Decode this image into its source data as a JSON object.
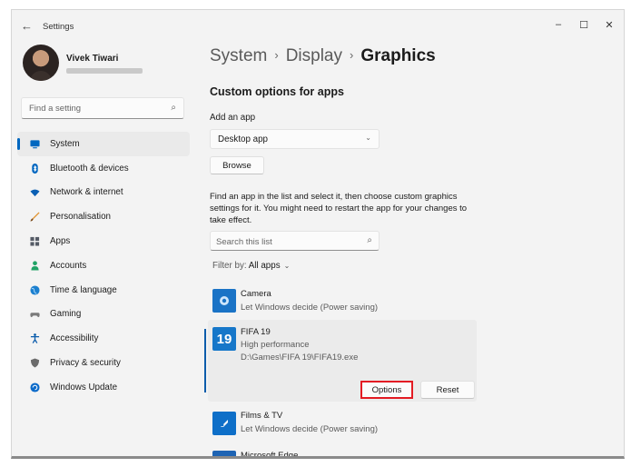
{
  "window": {
    "title": "Settings",
    "back_glyph": "←",
    "minimize_glyph": "–",
    "maximize_glyph": "☐",
    "close_glyph": "✕"
  },
  "user": {
    "name": "Vivek Tiwari"
  },
  "sidebar": {
    "search_placeholder": "Find a setting",
    "items": [
      {
        "label": "System",
        "icon": "monitor-icon",
        "color": "#0067c0",
        "active": true
      },
      {
        "label": "Bluetooth & devices",
        "icon": "bluetooth-icon",
        "color": "#0067c0"
      },
      {
        "label": "Network & internet",
        "icon": "wifi-icon",
        "color": "#0a5fb4"
      },
      {
        "label": "Personalisation",
        "icon": "brush-icon",
        "color": "#e0902a"
      },
      {
        "label": "Apps",
        "icon": "apps-icon",
        "color": "#555b66"
      },
      {
        "label": "Accounts",
        "icon": "person-icon",
        "color": "#21a366"
      },
      {
        "label": "Time & language",
        "icon": "globe-icon",
        "color": "#1b7fcf"
      },
      {
        "label": "Gaming",
        "icon": "gamepad-icon",
        "color": "#7a7a7a"
      },
      {
        "label": "Accessibility",
        "icon": "accessibility-icon",
        "color": "#0b5cab"
      },
      {
        "label": "Privacy & security",
        "icon": "shield-icon",
        "color": "#6b6b6b"
      },
      {
        "label": "Windows Update",
        "icon": "update-icon",
        "color": "#0b6ac9"
      }
    ]
  },
  "breadcrumb": {
    "level1": "System",
    "level2": "Display",
    "current": "Graphics",
    "separator": "›"
  },
  "main": {
    "section_title": "Custom options for apps",
    "add_app_label": "Add an app",
    "app_type_selected": "Desktop app",
    "browse_label": "Browse",
    "info_text": "Find an app in the list and select it, then choose custom graphics settings for it. You might need to restart the app for your changes to take effect.",
    "list_search_placeholder": "Search this list",
    "filter_label": "Filter by:",
    "filter_value": "All apps"
  },
  "apps": {
    "camera": {
      "name": "Camera",
      "setting": "Let Windows decide (Power saving)"
    },
    "fifa": {
      "icon_text": "19",
      "name": "FIFA 19",
      "setting": "High performance",
      "path": "D:\\Games\\FIFA 19\\FIFA19.exe",
      "options_label": "Options",
      "reset_label": "Reset"
    },
    "films": {
      "name": "Films & TV",
      "setting": "Let Windows decide (Power saving)"
    },
    "edge": {
      "name": "Microsoft Edge"
    }
  },
  "colors": {
    "accent": "#0067c0",
    "highlight_border": "#e31b23"
  }
}
